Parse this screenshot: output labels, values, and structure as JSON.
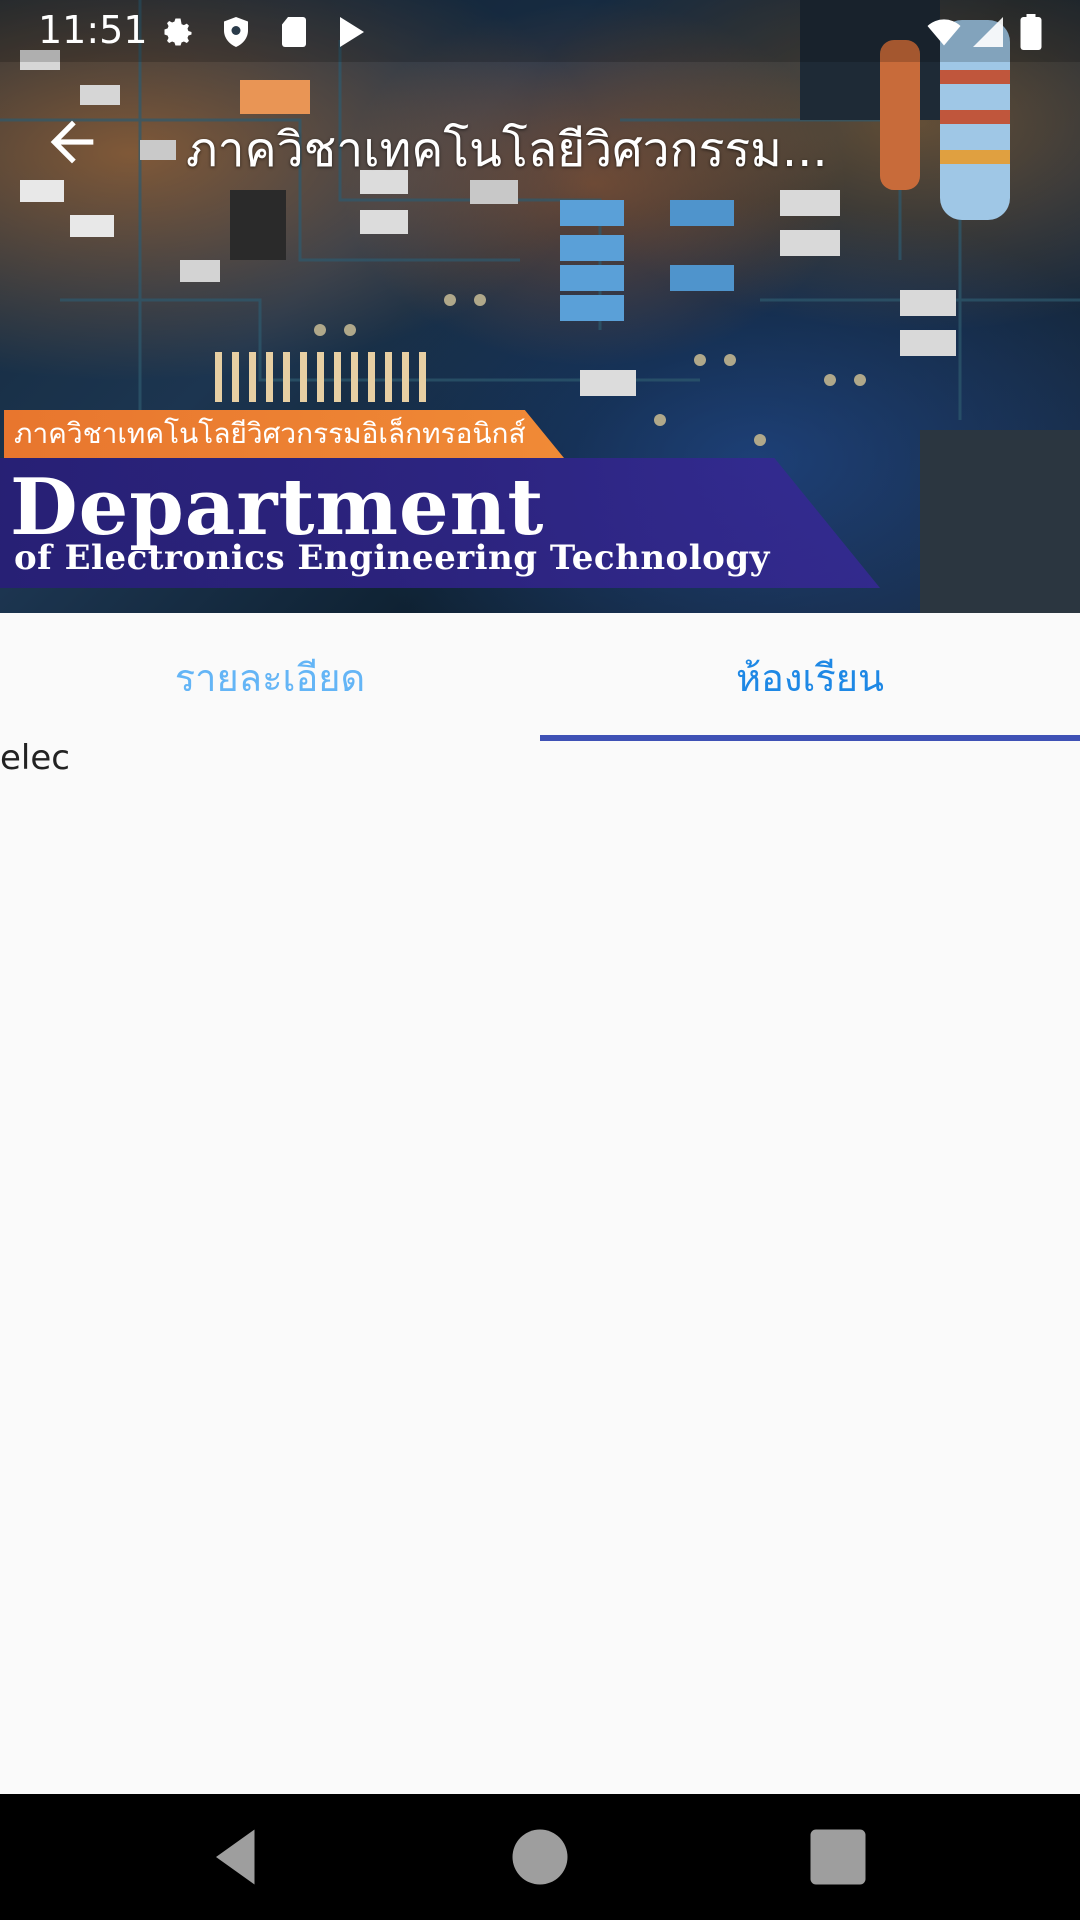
{
  "status_bar": {
    "time": "11:51",
    "icons": [
      "gear-icon",
      "shield-icon",
      "sd-card-icon",
      "play-store-icon",
      "wifi-icon",
      "signal-icon",
      "battery-icon"
    ]
  },
  "toolbar": {
    "back_icon": "arrow-back-icon",
    "title": "ภาควิชาเทคโนโลยีวิศวกรรม..."
  },
  "banner": {
    "thai_label": "ภาควิชาเทคโนโลยีวิศวกรรมอิเล็กทรอนิกส์",
    "title": "Department",
    "subtitle": "of Electronics Engineering Technology"
  },
  "tabs": [
    {
      "label": "รายละเอียด",
      "selected": false
    },
    {
      "label": "ห้องเรียน",
      "selected": true
    }
  ],
  "content": {
    "text": "elec"
  },
  "nav_bar": {
    "icons": [
      "nav-back-icon",
      "nav-home-icon",
      "nav-recents-icon"
    ]
  },
  "colors": {
    "tab_indicator": "#3f51b5",
    "tab_selected": "#1e88e5",
    "tab_unselected": "#64b5f6",
    "background": "#fafafa"
  }
}
